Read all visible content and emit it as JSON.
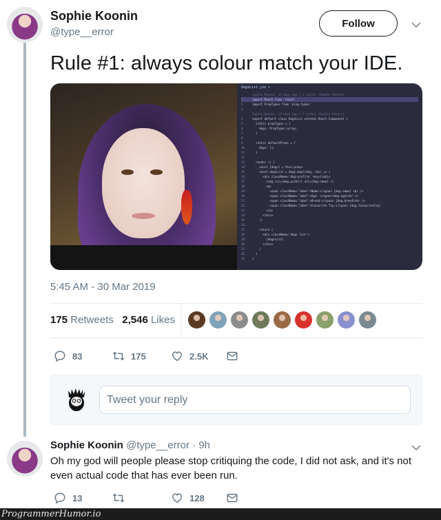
{
  "tweet": {
    "author_name": "Sophie Koonin",
    "author_handle": "@type__error",
    "follow_label": "Follow",
    "text": "Rule #1: always colour match your IDE.",
    "timestamp": "5:45 AM - 30 Mar 2019",
    "media": {
      "photo_alt": "Selfie of a woman with purple hair and flame earrings",
      "code": {
        "tab_label": "DogsList.jsx ×",
        "blame_1": "Sophie Koonin, 14 days ago | 1 author (Sophie Koonin)",
        "blame_2": "Sophie Koonin, 14 days ago | 1 author (Sophie Koonin)",
        "lines": [
          {
            "n": "1",
            "t": "import React from 'react'"
          },
          {
            "n": "2",
            "t": "import PropTypes from 'prop-types'"
          },
          {
            "n": "3",
            "t": ""
          },
          {
            "n": "4",
            "t": "export default class DogsList extends React.Component {"
          },
          {
            "n": "5",
            "t": "  static propTypes = {"
          },
          {
            "n": "6",
            "t": "    dogs: PropTypes.array,"
          },
          {
            "n": "7",
            "t": "  }"
          },
          {
            "n": "8",
            "t": ""
          },
          {
            "n": "9",
            "t": "  static defaultProps = {"
          },
          {
            "n": "10",
            "t": "    dogs: [],"
          },
          {
            "n": "11",
            "t": "  }"
          },
          {
            "n": "12",
            "t": ""
          },
          {
            "n": "13",
            "t": "  render () {"
          },
          {
            "n": "14",
            "t": "    const {dogs} = this.props"
          },
          {
            "n": "15",
            "t": "    const dogsList = dogs.map((dog, idx) => ("
          },
          {
            "n": "16",
            "t": "      <div className='dog-profile' key={idx}>"
          },
          {
            "n": "17",
            "t": "        <img src={dog.picUrl} alt={dog.name} />"
          },
          {
            "n": "18",
            "t": "        <p>"
          },
          {
            "n": "19",
            "t": "          <span className='label'>Name:</span> {dog.name} <br />"
          },
          {
            "n": "20",
            "t": "          <span className='label'>Age: </span>{dog.age}<br />"
          },
          {
            "n": "21",
            "t": "          <span className='label'>Breed:</span> {dog.breed}<br />"
          },
          {
            "n": "22",
            "t": "          <span className='label'>Favourite Toy:</span> {dog.favouriteToy}"
          },
          {
            "n": "23",
            "t": "        </p>"
          },
          {
            "n": "24",
            "t": "      </div>"
          },
          {
            "n": "25",
            "t": "    ))"
          },
          {
            "n": "26",
            "t": ""
          },
          {
            "n": "27",
            "t": "    return ("
          },
          {
            "n": "28",
            "t": "      <div className='dogs-list'>"
          },
          {
            "n": "29",
            "t": "        {dogsList}"
          },
          {
            "n": "30",
            "t": "      </div>"
          },
          {
            "n": "31",
            "t": "    )"
          },
          {
            "n": "32",
            "t": "  }"
          },
          {
            "n": "33",
            "t": "}"
          }
        ]
      }
    },
    "stats": {
      "retweets_count": "175",
      "retweets_label": "Retweets",
      "likes_count": "2,546",
      "likes_label": "Likes",
      "liker_colors": [
        "#5a3a22",
        "#7fa3b8",
        "#8c8c8c",
        "#6e7a5a",
        "#9a6a48",
        "#d9322c",
        "#8aa06a",
        "#8a8fd0",
        "#7a8a90"
      ]
    },
    "actions": {
      "replies": "83",
      "retweets": "175",
      "likes": "2.5K"
    },
    "reply_box": {
      "placeholder": "Tweet your reply"
    }
  },
  "reply": {
    "author_name": "Sophie Koonin",
    "author_handle": "@type__error",
    "time": "· 9h",
    "text": "Oh my god will people please stop critiquing the code, I did not ask, and it's not even actual code that has ever been run.",
    "actions": {
      "replies": "13",
      "retweets": "",
      "likes": "128"
    }
  },
  "watermark": "ProgrammerHumor.io",
  "colors": {
    "text": "#14171a",
    "secondary": "#657786",
    "divider": "#e6ecf0",
    "thread_line": "#aab8c2",
    "ide_background": "#2a2b3d"
  }
}
